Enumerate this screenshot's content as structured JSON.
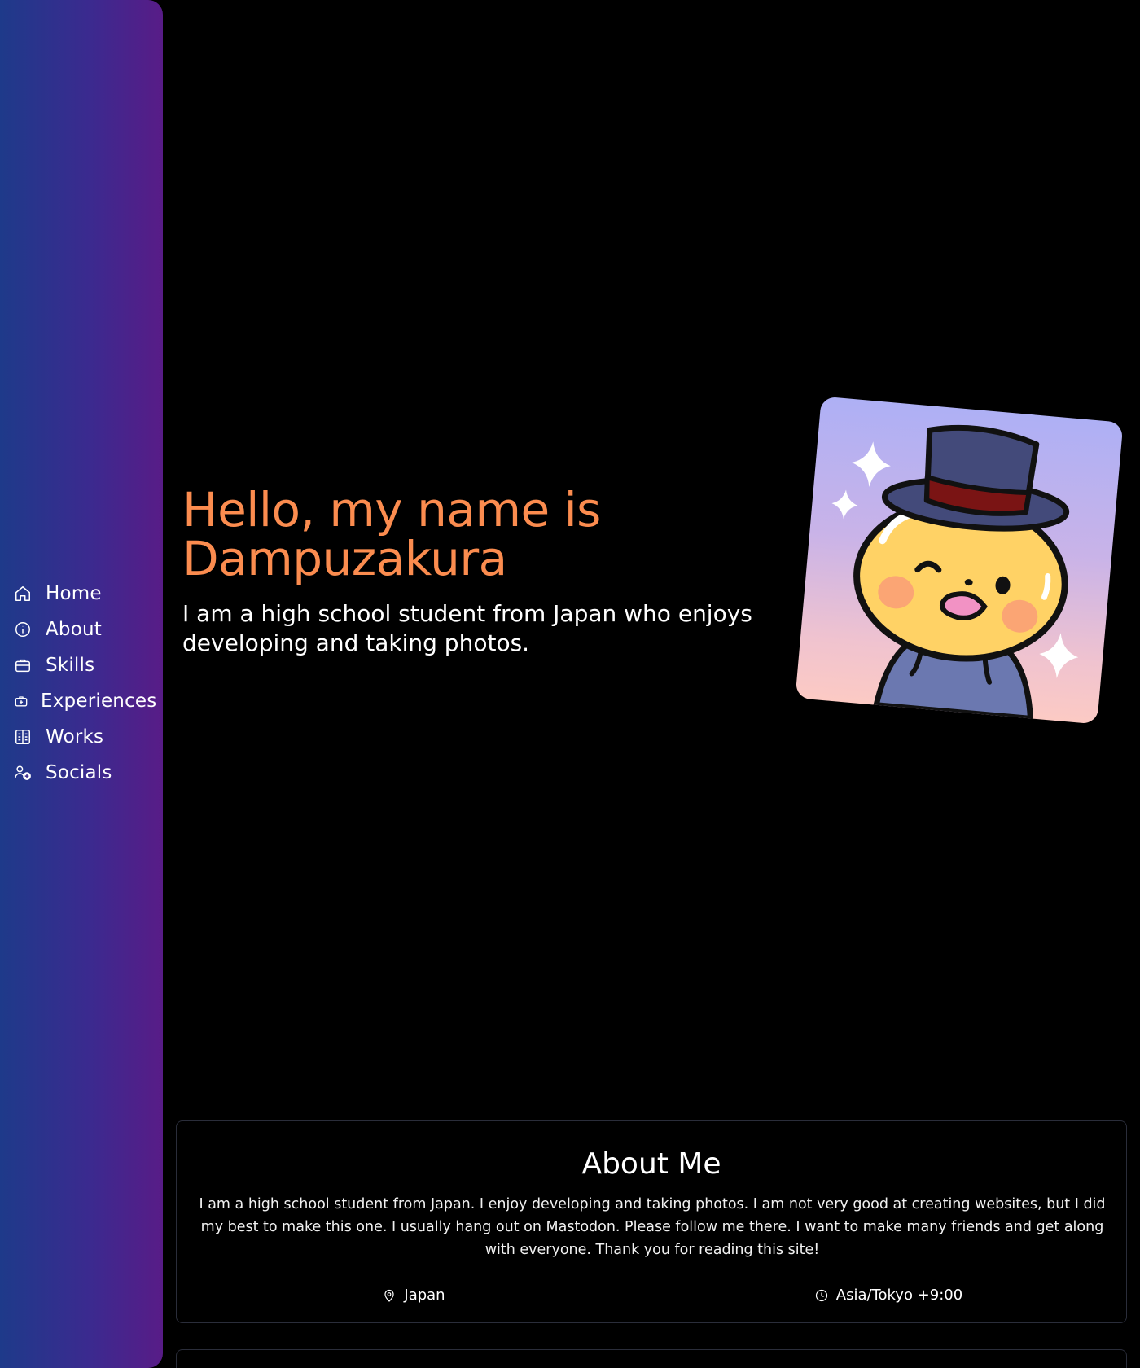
{
  "sidebar": {
    "items": [
      {
        "label": "Home",
        "icon": "home-icon"
      },
      {
        "label": "About",
        "icon": "info-icon"
      },
      {
        "label": "Skills",
        "icon": "briefcase-icon"
      },
      {
        "label": "Experiences",
        "icon": "briefcase-plus-icon"
      },
      {
        "label": "Works",
        "icon": "grid-book-icon"
      },
      {
        "label": "Socials",
        "icon": "users-plus-icon"
      }
    ]
  },
  "hero": {
    "title": "Hello, my name is Dampuzakura",
    "subtitle": "I am a high school student from Japan who enjoys developing and taking photos.",
    "avatar_icon": "top-hat-mascot-avatar"
  },
  "about": {
    "title": "About Me",
    "text": "I am a high school student from Japan. I enjoy developing and taking photos. I am not very good at creating websites, but I did my best to make this one. I usually hang out on Mastodon. Please follow me there. I want to make many friends and get along with everyone. Thank you for reading this site!",
    "location": "Japan",
    "location_icon": "map-pin-icon",
    "timezone": "Asia/Tokyo +9:00",
    "timezone_icon": "clock-icon"
  },
  "colors": {
    "accent": "#fb8c4f",
    "sidebar_gradient_start": "#1e3a8a",
    "sidebar_gradient_end": "#581c87",
    "background": "#000000"
  }
}
